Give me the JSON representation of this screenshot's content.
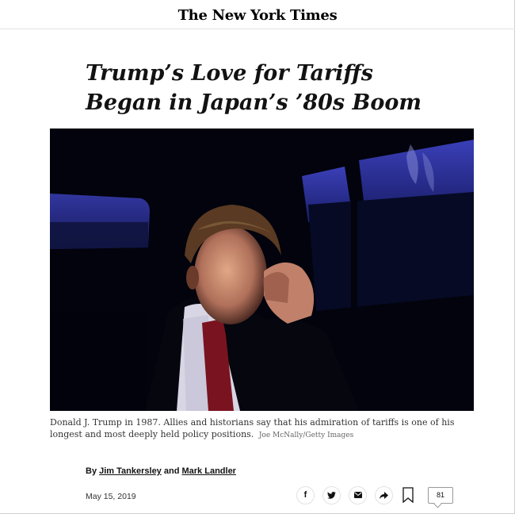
{
  "masthead": {
    "logo_text": "The New York Times"
  },
  "article": {
    "headline_line1": "Trump’s Love for Tariffs",
    "headline_line2": "Began in Japan’s ’80s Boom",
    "caption": "Donald J. Trump in 1987. Allies and historians say that his admiration of tariffs is one of his longest and most deeply held policy positions.",
    "credit": "Joe McNally/Getty Images",
    "byline_prefix": "By",
    "author1": "Jim Tankersley",
    "byline_and": "and",
    "author2": "Mark Landler",
    "date": "May 15, 2019"
  },
  "share": {
    "facebook_label": "f",
    "twitter_icon": "twitter-icon",
    "email_icon": "email-icon",
    "share_icon": "share-arrow-icon",
    "bookmark_icon": "bookmark-icon",
    "comment_count": "81"
  }
}
